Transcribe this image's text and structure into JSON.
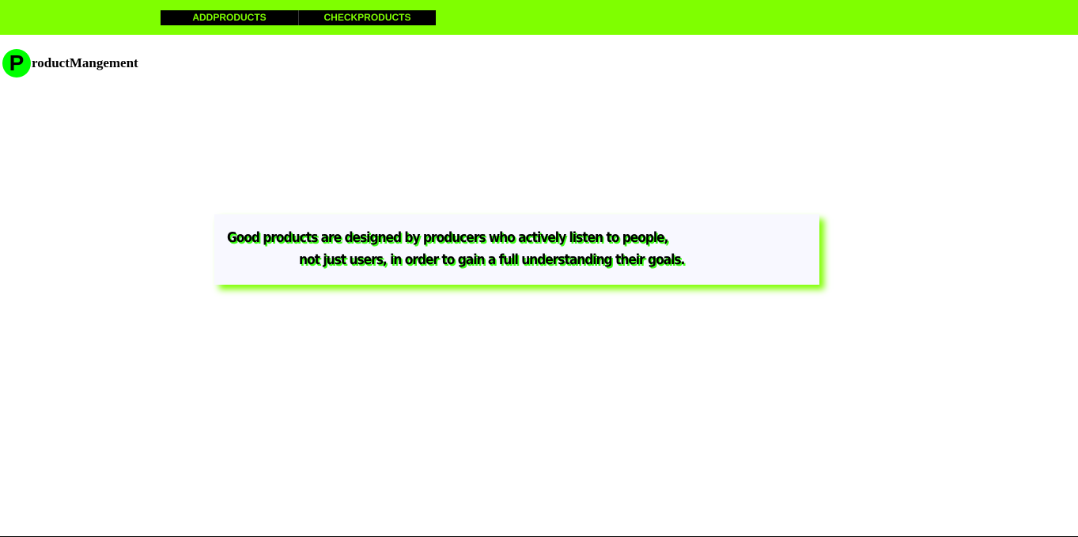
{
  "nav": {
    "items": [
      {
        "label": "ADDPRODUCTS"
      },
      {
        "label": "CHECKPRODUCTS"
      }
    ]
  },
  "brand": {
    "logo_letter": "P",
    "text": "roductMangement"
  },
  "quote": {
    "line1": "Good products are designed by producers who actively listen to people,",
    "line2": "not just users, in order to gain a full understanding their goals."
  },
  "colors": {
    "accent": "#7fff00",
    "logo": "#00ff00",
    "nav_background": "#000000",
    "quote_background": "#f8f8ff"
  }
}
